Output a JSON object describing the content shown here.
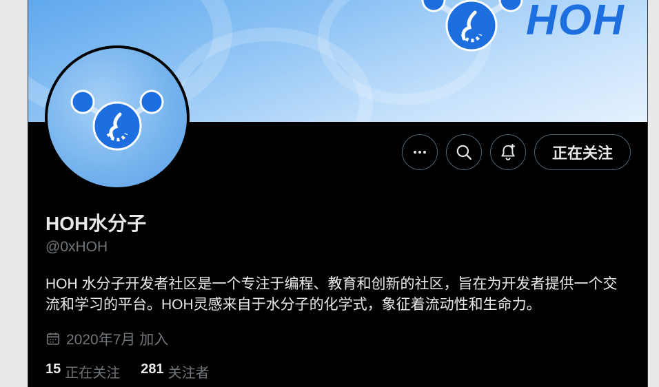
{
  "banner": {
    "brand": "HOH"
  },
  "profile": {
    "name": "HOH水分子",
    "handle": "@0xHOH",
    "bio": "HOH 水分子开发者社区是一个专注于编程、教育和创新的社区，旨在为开发者提供一个交流和学习的平台。HOH灵感来自于水分子的化学式，象征着流动性和生命力。",
    "joined": "2020年7月 加入"
  },
  "actions": {
    "follow_label": "正在关注"
  },
  "stats": {
    "following_count": "15",
    "following_label": "正在关注",
    "followers_count": "281",
    "followers_label": "关注者"
  },
  "colors": {
    "brand_blue": "#1d6fe0",
    "background": "#000000",
    "text": "#e7e9ea",
    "muted": "#71767b"
  },
  "icons": [
    "more-icon",
    "search-icon",
    "notification-bell-icon",
    "calendar-icon"
  ]
}
